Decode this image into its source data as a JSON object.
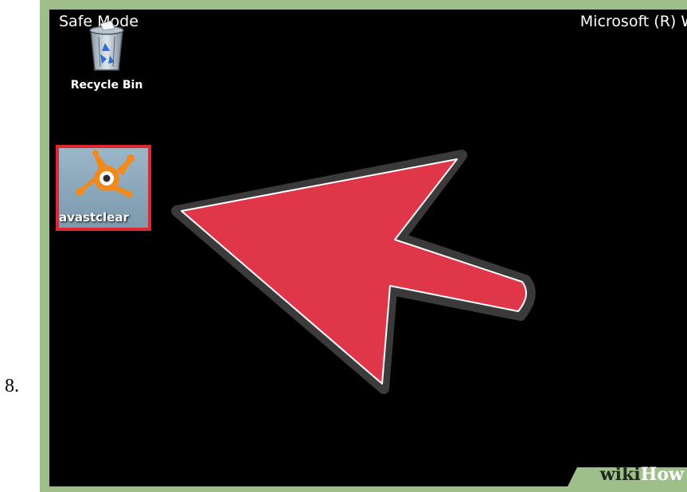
{
  "step": {
    "number": "8."
  },
  "desktop": {
    "mode_label": "Safe Mode",
    "os_label": "Microsoft (R) Wi",
    "icons": [
      {
        "label": "Recycle Bin",
        "icon": "recycle-bin-icon"
      },
      {
        "label": "avastclear",
        "icon": "avast-icon",
        "highlighted": true
      }
    ]
  },
  "annotation": {
    "arrow_color": "#e0364a",
    "highlight_color": "#e0262e"
  },
  "watermark": {
    "part1": "wiki",
    "part2": "How"
  },
  "colors": {
    "frame": "#9fbf8a",
    "desktop": "#000000",
    "avast_orange": "#f08a1e"
  }
}
